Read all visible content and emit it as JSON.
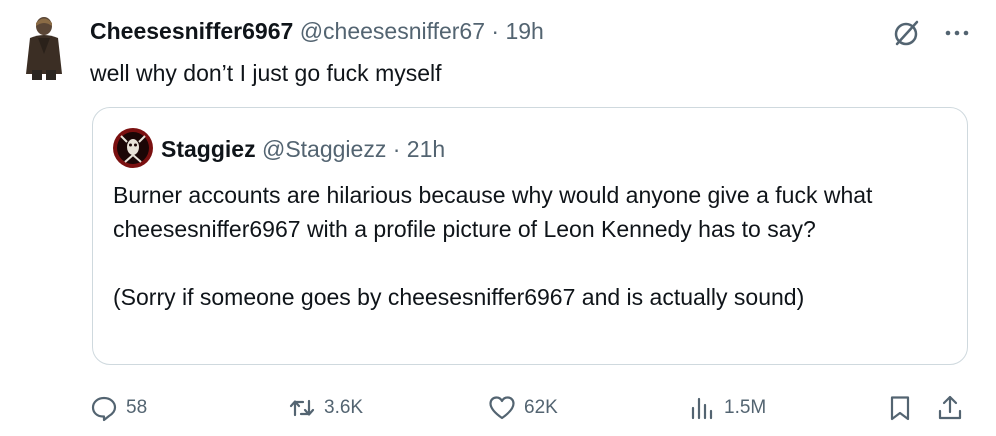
{
  "tweet": {
    "display_name": "Cheesesniffer6967",
    "handle": "@cheesesniffer67",
    "separator": "·",
    "time": "19h",
    "text": "well why don’t I just go fuck myself",
    "icons": {
      "grok": "grok-icon",
      "more": "more-dots-icon"
    }
  },
  "quote": {
    "display_name": "Staggiez",
    "handle": "@Staggiezz",
    "separator": "·",
    "time": "21h",
    "paragraph1": "Burner accounts are hilarious because why would anyone give a fuck what cheesesniffer6967 with a profile picture of Leon Kennedy has to say?",
    "paragraph2": "(Sorry if someone goes by cheesesniffer6967 and is actually sound)"
  },
  "actions": {
    "replies": "58",
    "reposts": "3.6K",
    "likes": "62K",
    "views": "1.5M"
  },
  "colors": {
    "text": "#0f1419",
    "muted": "#536471",
    "border": "#cfd9de",
    "quote_avatar_bg": "#7a1010"
  }
}
